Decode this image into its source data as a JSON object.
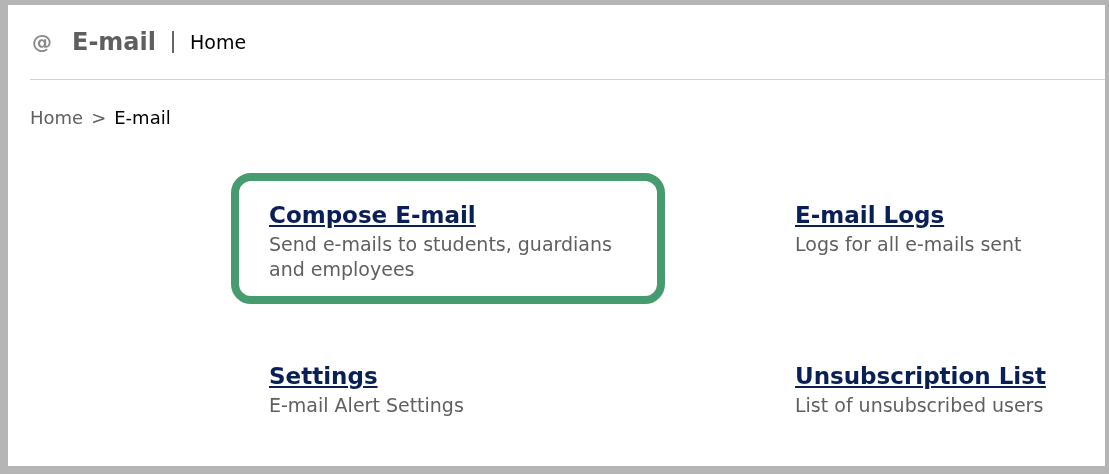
{
  "header": {
    "icon": "@",
    "title": "E-mail",
    "section": "Home"
  },
  "breadcrumb": [
    {
      "label": "Home",
      "current": false
    },
    {
      "label": "E-mail",
      "current": true
    }
  ],
  "breadcrumb_separator": ">",
  "items": [
    {
      "title": "Compose E-mail",
      "description": "Send e-mails to students, guardians and employees",
      "highlighted": true
    },
    {
      "title": "E-mail Logs",
      "description": "Logs for all e-mails sent",
      "highlighted": false
    },
    {
      "title": "Settings",
      "description": "E-mail Alert Settings",
      "highlighted": false
    },
    {
      "title": "Unsubscription List",
      "description": "List of unsubscribed users",
      "highlighted": false
    }
  ]
}
